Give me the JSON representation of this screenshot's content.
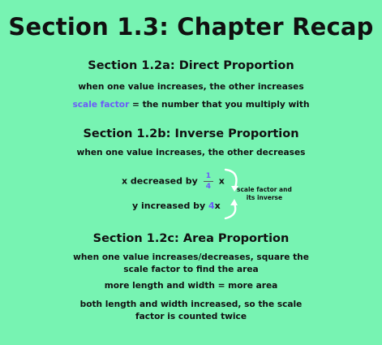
{
  "title": "Section 1.3: Chapter Recap",
  "sections": [
    {
      "heading": "Section 1.2a: Direct Proportion",
      "line1": "when one value increases, the other increases",
      "term": "scale factor",
      "definition": " = the number that you multiply with"
    },
    {
      "heading": "Section 1.2b: Inverse Proportion",
      "line1": "when one value increases, the other decreases",
      "x_prefix": "x decreased by",
      "frac_num": "1",
      "frac_den": "4",
      "x_suffix": "x",
      "y_prefix": "y increased by ",
      "y_value": "4",
      "y_suffix": "x",
      "note_line1": "scale factor and",
      "note_line2": "its inverse"
    },
    {
      "heading": "Section 1.2c: Area Proportion",
      "line1": "when one value increases/decreases, square the",
      "line2": "scale factor to find the area",
      "line3": "more length and width = more area",
      "line4": "both length and width increased, so the scale",
      "line5": "factor is counted twice"
    }
  ],
  "colors": {
    "background": "#77f3b2",
    "accent": "#6b5cf7",
    "text": "#111111"
  }
}
